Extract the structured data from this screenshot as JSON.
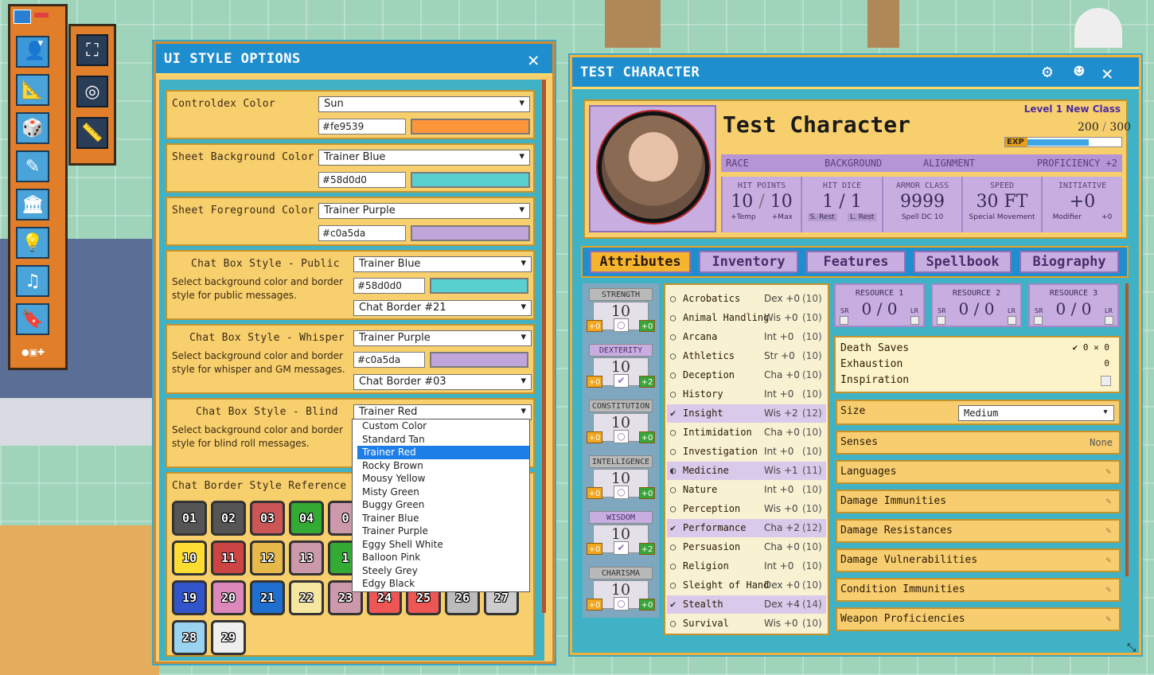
{
  "toolbar": {
    "tools": [
      {
        "name": "character-icon",
        "glyph": "👤"
      },
      {
        "name": "ruler-measure-icon",
        "glyph": "📐"
      },
      {
        "name": "dice-icon",
        "glyph": "🎲"
      },
      {
        "name": "pencil-icon",
        "glyph": "✎"
      },
      {
        "name": "library-icon",
        "glyph": "🏛"
      },
      {
        "name": "lightbulb-icon",
        "glyph": "💡"
      },
      {
        "name": "music-icon",
        "glyph": "♫"
      },
      {
        "name": "bookmark-icon",
        "glyph": "🔖"
      }
    ],
    "sub_tools": [
      {
        "name": "fullscreen-icon",
        "glyph": "⛶"
      },
      {
        "name": "target-icon",
        "glyph": "◎"
      },
      {
        "name": "measure-icon",
        "glyph": "📏"
      }
    ]
  },
  "ui_style": {
    "title": "UI STYLE OPTIONS",
    "close": "✕",
    "controldex": {
      "label": "Controldex Color",
      "select": "Sun",
      "hex": "#fe9539",
      "color": "#fe9539"
    },
    "sheet_bg": {
      "label": "Sheet Background Color",
      "select": "Trainer Blue",
      "hex": "#58d0d0",
      "color": "#58d0d0"
    },
    "sheet_fg": {
      "label": "Sheet Foreground Color",
      "select": "Trainer Purple",
      "hex": "#c0a5da",
      "color": "#c0a5da"
    },
    "chat_public": {
      "label": "Chat Box Style - Public",
      "desc": "Select background color and border style for public messages.",
      "select": "Trainer Blue",
      "hex": "#58d0d0",
      "color": "#58d0d0",
      "border": "Chat Border #21"
    },
    "chat_whisper": {
      "label": "Chat Box Style - Whisper",
      "desc": "Select background color and border style for whisper and GM messages.",
      "select": "Trainer Purple",
      "hex": "#c0a5da",
      "color": "#c0a5da",
      "border": "Chat Border #03"
    },
    "chat_blind": {
      "label": "Chat Box Style - Blind",
      "desc": "Select background color and border style for blind roll messages.",
      "select": "Trainer Red"
    },
    "dropdown": [
      "Custom Color",
      "Standard Tan",
      "Trainer Red",
      "Rocky Brown",
      "Mousy Yellow",
      "Misty Green",
      "Buggy Green",
      "Trainer Blue",
      "Trainer Purple",
      "Eggy Shell White",
      "Balloon Pink",
      "Steely Grey",
      "Edgy Black"
    ],
    "dropdown_selected": "Trainer Red",
    "ref_title": "Chat Border Style Reference",
    "borders": [
      "01",
      "02",
      "03",
      "04",
      "0",
      "10",
      "11",
      "12",
      "13",
      "1",
      "19",
      "20",
      "21",
      "22",
      "23",
      "24",
      "25",
      "26",
      "27",
      "28",
      "29"
    ]
  },
  "sheet": {
    "title": "TEST CHARACTER",
    "name": "Test Character",
    "level": "Level 1 New Class",
    "exp_cur": "200",
    "exp_max": "300",
    "exp_label": "EXP",
    "exp_fraction": 0.667,
    "race": "RACE",
    "background": "BACKGROUND",
    "alignment": "ALIGNMENT",
    "proficiency": "PROFICIENCY +2",
    "hit_points": {
      "h": "HIT POINTS",
      "cur": "10",
      "max": "10",
      "a": "+Temp",
      "b": "+Max"
    },
    "hit_dice": {
      "h": "HIT DICE",
      "v": "1 / 1",
      "a": "S. Rest",
      "b": "L. Rest"
    },
    "armor": {
      "h": "ARMOR CLASS",
      "v": "9999",
      "a": "Spell DC 10"
    },
    "speed": {
      "h": "SPEED",
      "v": "30 FT",
      "a": "Special Movement"
    },
    "initiative": {
      "h": "INITIATIVE",
      "v": "+0",
      "a": "Modifier",
      "b": "+0"
    },
    "tabs": [
      "Attributes",
      "Inventory",
      "Features",
      "Spellbook",
      "Biography"
    ],
    "abilities": [
      {
        "n": "STRENGTH",
        "v": "10",
        "l": "+0",
        "r": "+0",
        "p": false
      },
      {
        "n": "DEXTERITY",
        "v": "10",
        "l": "+0",
        "r": "+2",
        "p": true
      },
      {
        "n": "CONSTITUTION",
        "v": "10",
        "l": "+0",
        "r": "+0",
        "p": false
      },
      {
        "n": "INTELLIGENCE",
        "v": "10",
        "l": "+0",
        "r": "+0",
        "p": false
      },
      {
        "n": "WISDOM",
        "v": "10",
        "l": "+0",
        "r": "+2",
        "p": true
      },
      {
        "n": "CHARISMA",
        "v": "10",
        "l": "+0",
        "r": "+0",
        "p": false
      }
    ],
    "skills": [
      {
        "n": "Acrobatics",
        "s": "Dex +0",
        "p": "(10)",
        "m": "○"
      },
      {
        "n": "Animal Handling",
        "s": "Wis +0",
        "p": "(10)",
        "m": "○"
      },
      {
        "n": "Arcana",
        "s": "Int  +0",
        "p": "(10)",
        "m": "○"
      },
      {
        "n": "Athletics",
        "s": "Str  +0",
        "p": "(10)",
        "m": "○"
      },
      {
        "n": "Deception",
        "s": "Cha +0",
        "p": "(10)",
        "m": "○"
      },
      {
        "n": "History",
        "s": "Int  +0",
        "p": "(10)",
        "m": "○"
      },
      {
        "n": "Insight",
        "s": "Wis +2",
        "p": "(12)",
        "m": "✔"
      },
      {
        "n": "Intimidation",
        "s": "Cha +0",
        "p": "(10)",
        "m": "○"
      },
      {
        "n": "Investigation",
        "s": "Int  +0",
        "p": "(10)",
        "m": "○"
      },
      {
        "n": "Medicine",
        "s": "Wis +1",
        "p": "(11)",
        "m": "◐"
      },
      {
        "n": "Nature",
        "s": "Int  +0",
        "p": "(10)",
        "m": "○"
      },
      {
        "n": "Perception",
        "s": "Wis +0",
        "p": "(10)",
        "m": "○"
      },
      {
        "n": "Performance",
        "s": "Cha +2",
        "p": "(12)",
        "m": "✔"
      },
      {
        "n": "Persuasion",
        "s": "Cha +0",
        "p": "(10)",
        "m": "○"
      },
      {
        "n": "Religion",
        "s": "Int  +0",
        "p": "(10)",
        "m": "○"
      },
      {
        "n": "Sleight of Hand",
        "s": "Dex +0",
        "p": "(10)",
        "m": "○"
      },
      {
        "n": "Stealth",
        "s": "Dex +4",
        "p": "(14)",
        "m": "✔"
      },
      {
        "n": "Survival",
        "s": "Wis +0",
        "p": "(10)",
        "m": "○"
      }
    ],
    "resources": [
      {
        "h": "RESOURCE 1",
        "v": "0 / 0"
      },
      {
        "h": "RESOURCE 2",
        "v": "0 / 0"
      },
      {
        "h": "RESOURCE 3",
        "v": "0 / 0"
      }
    ],
    "death_saves": "Death Saves",
    "ds_check": "✔",
    "ds_s": "0",
    "ds_x": "✕",
    "ds_f": "0",
    "exhaustion": "Exhaustion",
    "exhaustion_v": "0",
    "inspiration": "Inspiration",
    "size_label": "Size",
    "size_value": "Medium",
    "senses": "Senses",
    "senses_v": "None",
    "rows": [
      "Languages",
      "Damage Immunities",
      "Damage Resistances",
      "Damage Vulnerabilities",
      "Condition Immunities",
      "Weapon Proficiencies"
    ]
  }
}
